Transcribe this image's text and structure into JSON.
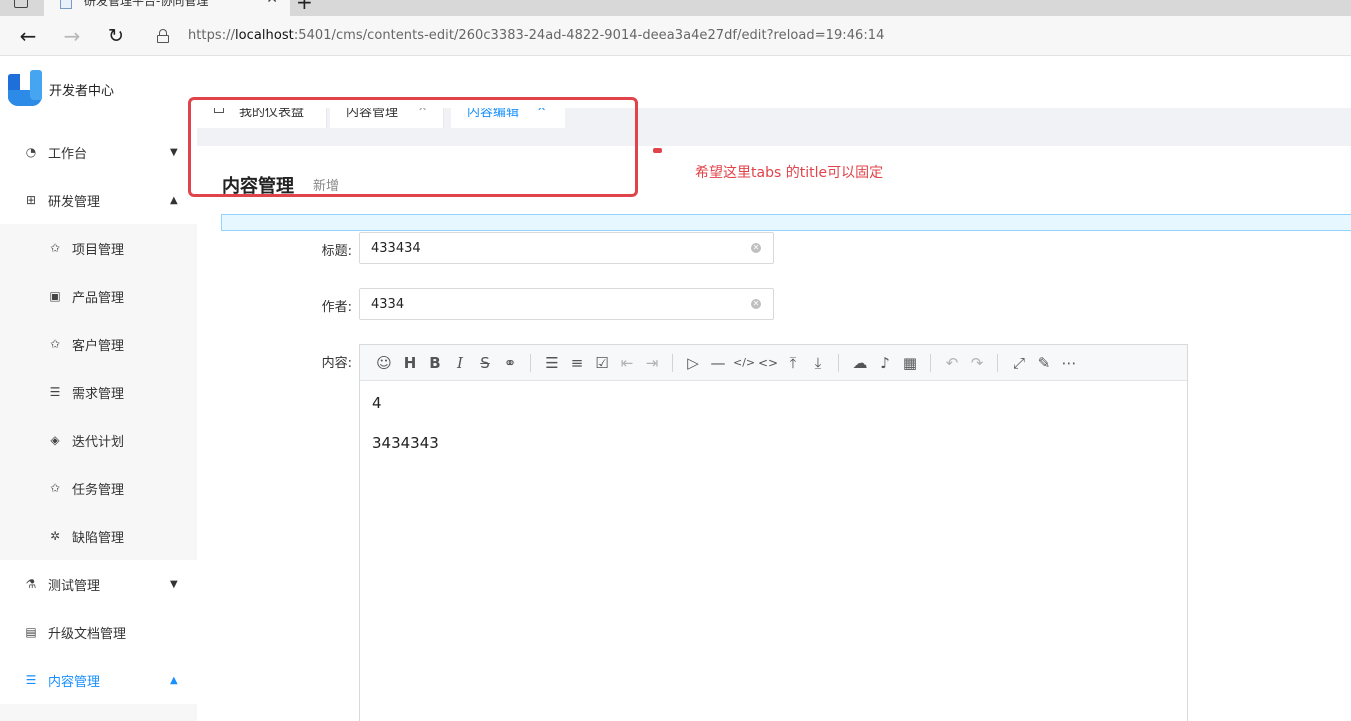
{
  "browser": {
    "tab_title": "研发管理平台-协同管理",
    "url_prefix": "https://",
    "url_host": "localhost",
    "url_rest": ":5401/cms/contents-edit/260c3383-24ad-4822-9014-deea3a4e27df/edit?reload=19:46:14"
  },
  "app": {
    "name": "开发者中心"
  },
  "sidebar": {
    "items": [
      {
        "label": "工作台",
        "icon": "dashboard-icon",
        "chevron": "down"
      },
      {
        "label": "研发管理",
        "icon": "cluster-icon",
        "chevron": "up"
      },
      {
        "label": "项目管理",
        "icon": "project-icon"
      },
      {
        "label": "产品管理",
        "icon": "product-icon"
      },
      {
        "label": "客户管理",
        "icon": "customer-icon"
      },
      {
        "label": "需求管理",
        "icon": "list-icon"
      },
      {
        "label": "迭代计划",
        "icon": "target-icon"
      },
      {
        "label": "任务管理",
        "icon": "task-icon"
      },
      {
        "label": "缺陷管理",
        "icon": "bug-icon"
      },
      {
        "label": "测试管理",
        "icon": "flask-icon",
        "chevron": "down"
      },
      {
        "label": "升级文档管理",
        "icon": "document-icon"
      },
      {
        "label": "内容管理",
        "icon": "list-icon",
        "chevron": "up"
      }
    ]
  },
  "content_tabs": [
    {
      "label": "我的仪表盘",
      "closable": false
    },
    {
      "label": "内容管理",
      "closable": true
    },
    {
      "label": "内容编辑",
      "closable": true,
      "active": true
    }
  ],
  "page": {
    "title": "内容管理",
    "subtitle": "新增"
  },
  "annotation": {
    "text": "希望这里tabs 的title可以固定",
    "color": "#e0434a"
  },
  "form": {
    "title_label": "标题:",
    "title_value": "433434",
    "author_label": "作者:",
    "author_value": "4334",
    "content_label": "内容:",
    "content_lines": [
      "4",
      "3434343"
    ]
  },
  "editor_toolbar": [
    "emoji-icon",
    "heading-icon",
    "bold-icon",
    "italic-icon",
    "strikethrough-icon",
    "link-icon",
    "unordered-list-icon",
    "ordered-list-icon",
    "checklist-icon",
    "outdent-icon",
    "indent-icon",
    "quote-icon",
    "hr-icon",
    "code-icon",
    "inline-code-icon",
    "insert-before-icon",
    "insert-after-icon",
    "upload-icon",
    "record-icon",
    "table-icon",
    "undo-icon",
    "redo-icon",
    "fullscreen-icon",
    "edit-mode-icon",
    "more-icon"
  ],
  "colors": {
    "accent": "#1890ff",
    "annotation": "#e0434a",
    "info_bg": "#e6f7ff"
  }
}
